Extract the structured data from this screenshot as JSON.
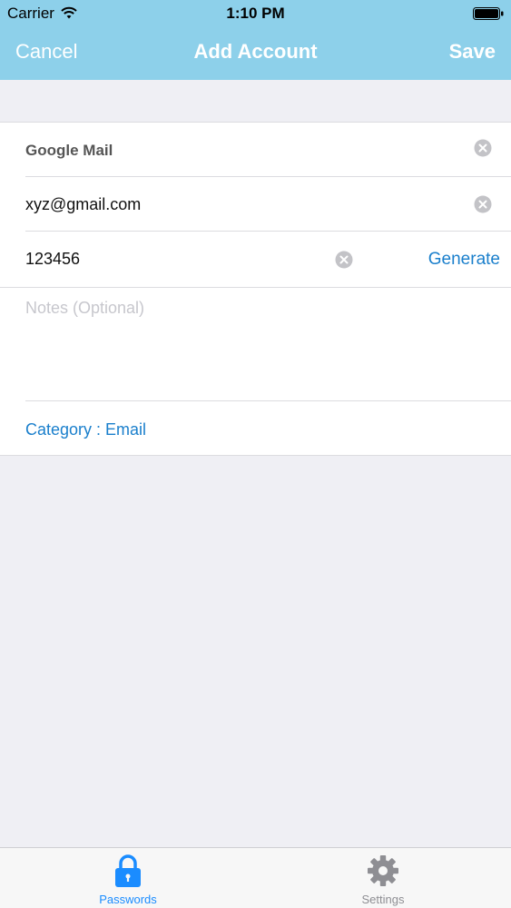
{
  "status_bar": {
    "carrier": "Carrier",
    "time": "1:10 PM"
  },
  "nav": {
    "cancel": "Cancel",
    "title": "Add Account",
    "save": "Save"
  },
  "form": {
    "account_name": "Google Mail",
    "username": "xyz@gmail.com",
    "password": "123456",
    "generate_label": "Generate",
    "notes_placeholder": "Notes (Optional)",
    "category": "Category : Email"
  },
  "tabs": [
    {
      "label": "Passwords",
      "icon": "lock-icon",
      "active": true
    },
    {
      "label": "Settings",
      "icon": "gear-icon",
      "active": false
    }
  ],
  "colors": {
    "nav_background": "#8dd0ea",
    "accent": "#1a7fcc",
    "tab_active": "#1a8cff",
    "tab_inactive": "#8e8e93",
    "page_background": "#efeff4"
  }
}
